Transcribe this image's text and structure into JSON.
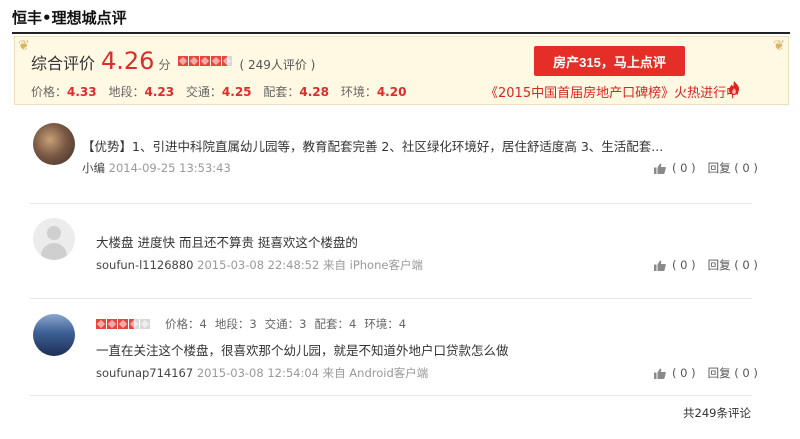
{
  "page_title": "恒丰•理想城点评",
  "summary": {
    "label": "综合评价",
    "score": "4.26",
    "unit": "分",
    "stars": [
      "full",
      "full",
      "full",
      "full",
      "half"
    ],
    "count_text": "( 249人评价 )",
    "sub_scores": [
      {
        "label": "价格：",
        "value": "4.33"
      },
      {
        "label": "地段：",
        "value": "4.23"
      },
      {
        "label": "交通：",
        "value": "4.25"
      },
      {
        "label": "配套：",
        "value": "4.28"
      },
      {
        "label": "环境：",
        "value": "4.20"
      }
    ],
    "button_label": "房产315，马上点评",
    "promo_text": "《2015中国首届房地产口碑榜》火热进行中",
    "accent_color": "#e52e27"
  },
  "reviews": [
    {
      "text": "【优势】1、引进中科院直属幼儿园等，教育配套完善 2、社区绿化环境好，居住舒适度高 3、生活配套...",
      "user": "小编",
      "meta": "2014-09-25 13:53:43",
      "likes": "( 0 )",
      "reply": "回复 ( 0 )"
    },
    {
      "text": "大楼盘 进度快 而且还不算贵 挺喜欢这个楼盘的",
      "user": "soufun-l1126880",
      "meta": "2015-03-08 22:48:52 来自 iPhone客户端",
      "likes": "( 0 )",
      "reply": "回复 ( 0 )"
    },
    {
      "rating_stars": [
        "full",
        "full",
        "full",
        "half",
        "empty"
      ],
      "rating": [
        "价格：4",
        "地段：3",
        "交通：3",
        "配套：4",
        "环境：4"
      ],
      "text": "一直在关注这个楼盘，很喜欢那个幼儿园，就是不知道外地户口贷款怎么做",
      "user": "soufunap714167",
      "meta": "2015-03-08 12:54:04 来自 Android客户端",
      "likes": "( 0 )",
      "reply": "回复 ( 0 )"
    }
  ],
  "total_text": "共249条评论"
}
